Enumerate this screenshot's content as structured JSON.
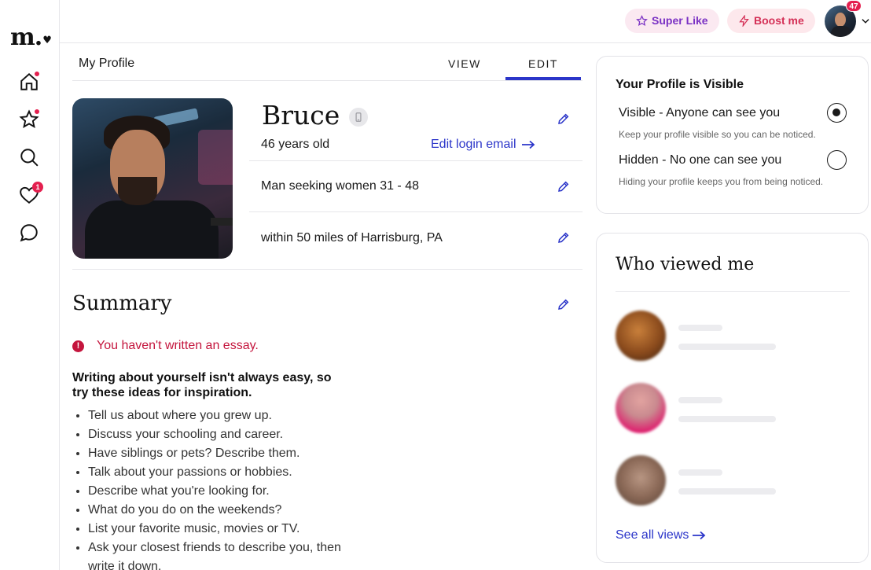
{
  "brand": {
    "logo_text": "m.",
    "accent": "#2b35c9",
    "alert": "#e4204f"
  },
  "nav": {
    "items": [
      {
        "name": "home",
        "icon": "home-icon",
        "indicator": "dot"
      },
      {
        "name": "favorites",
        "icon": "star-icon",
        "indicator": "dot"
      },
      {
        "name": "search",
        "icon": "search-icon",
        "indicator": ""
      },
      {
        "name": "likes",
        "icon": "heart-icon",
        "indicator": "1"
      },
      {
        "name": "messages",
        "icon": "chat-bubble-icon",
        "indicator": ""
      }
    ]
  },
  "topbar": {
    "super_like_label": "Super Like",
    "boost_label": "Boost me",
    "notifications_count": "47"
  },
  "profile_tabs": {
    "section_label": "My Profile",
    "tabs": [
      {
        "label": "VIEW",
        "active": false
      },
      {
        "label": "EDIT",
        "active": true
      }
    ]
  },
  "profile": {
    "name": "Bruce",
    "age_text": "46 years old",
    "edit_login_email_label": "Edit login email",
    "seeking_text": "Man seeking women 31 - 48",
    "location_text": "within 50 miles of Harrisburg, PA"
  },
  "summary": {
    "title": "Summary",
    "warning": "You haven't written an essay.",
    "ideas_heading": "Writing about yourself isn't always easy, so try these ideas for inspiration.",
    "ideas": [
      "Tell us about where you grew up.",
      "Discuss your schooling and career.",
      "Have siblings or pets? Describe them.",
      "Talk about your passions or hobbies.",
      "Describe what you're looking for.",
      "What do you do on the weekends?",
      "List your favorite music, movies or TV.",
      "Ask your closest friends to describe you, then write it down."
    ]
  },
  "visibility": {
    "title": "Your Profile is Visible",
    "options": [
      {
        "label": "Visible - Anyone can see you",
        "sub": "Keep your profile visible so you can be noticed.",
        "selected": true
      },
      {
        "label": "Hidden - No one can see you",
        "sub": "Hiding your profile keeps you from being noticed.",
        "selected": false
      }
    ]
  },
  "viewers": {
    "title": "Who viewed me",
    "see_all_label": "See all views"
  }
}
